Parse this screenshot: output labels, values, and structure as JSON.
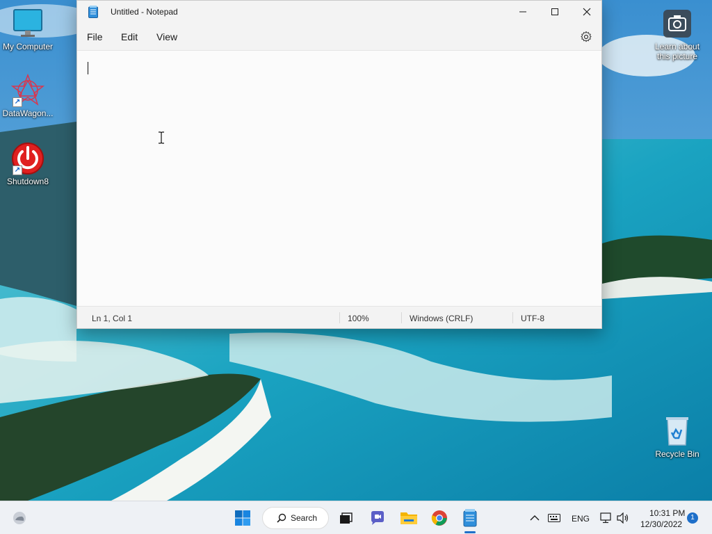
{
  "desktop": {
    "icons": [
      {
        "label": "My Computer",
        "icon": "monitor-icon"
      },
      {
        "label": "DataWagon...",
        "icon": "datawagon-icon"
      },
      {
        "label": "Shutdown8",
        "icon": "power-icon"
      },
      {
        "label": "Recycle Bin",
        "icon": "recycle-bin-icon"
      }
    ],
    "spotlight": {
      "line1": "Learn about",
      "line2": "this picture",
      "icon": "camera-icon"
    }
  },
  "notepad": {
    "title": "Untitled - Notepad",
    "menu": {
      "file": "File",
      "edit": "Edit",
      "view": "View"
    },
    "content": "",
    "status": {
      "position": "Ln 1, Col 1",
      "zoom": "100%",
      "line_endings": "Windows (CRLF)",
      "encoding": "UTF-8"
    }
  },
  "taskbar": {
    "search_label": "Search",
    "language": "ENG",
    "time": "10:31 PM",
    "date": "12/30/2022",
    "notification_count": "1"
  }
}
